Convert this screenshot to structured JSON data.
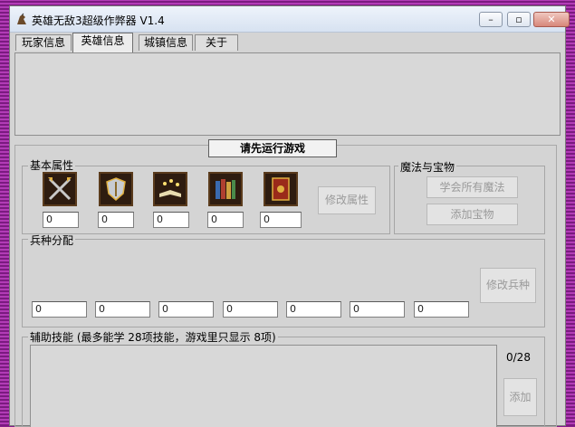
{
  "window": {
    "title": "英雄无敌3超级作弊器 V1.4",
    "minimize_glyph": "–",
    "maximize_glyph": "▫",
    "close_glyph": "✕"
  },
  "tabs": [
    {
      "label": "玩家信息",
      "active": false
    },
    {
      "label": "英雄信息",
      "active": true
    },
    {
      "label": "城镇信息",
      "active": false
    },
    {
      "label": "关于",
      "active": false
    }
  ],
  "status": {
    "label": "请先运行游戏"
  },
  "basic_attributes": {
    "title": "基本属性",
    "icons": [
      "attack-swords-icon",
      "defense-shield-icon",
      "spellpower-book-icon",
      "knowledge-books-icon",
      "spellbook-icon"
    ],
    "values": [
      "0",
      "0",
      "0",
      "0",
      "0"
    ],
    "modify_button": "修改属性"
  },
  "magic_treasure": {
    "title": "魔法与宝物",
    "learn_all_button": "学会所有魔法",
    "add_treasure_button": "添加宝物"
  },
  "troops": {
    "title": "兵种分配",
    "values": [
      "0",
      "0",
      "0",
      "0",
      "0",
      "0",
      "0"
    ],
    "modify_button": "修改兵种"
  },
  "skills": {
    "title": "辅助技能  (最多能学 28项技能，游戏里只显示 8项)",
    "counter": "0/28",
    "add_button": "添加"
  },
  "colors": {
    "background_stripe_dark": "#7b1a80",
    "background_stripe_light": "#b23cb6",
    "window_face": "#d4d4d4"
  }
}
